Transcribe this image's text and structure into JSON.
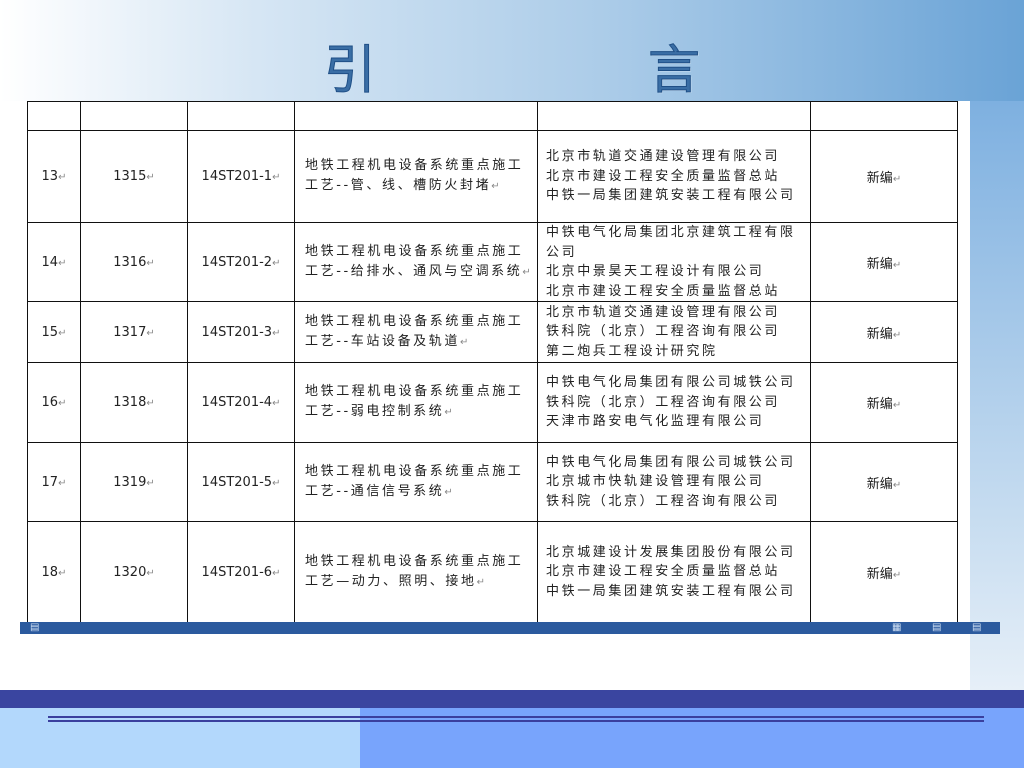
{
  "title": "引　言",
  "rows": [
    {
      "no": "13",
      "code": "1315",
      "std": "14ST201-1",
      "name": "地铁工程机电设备系统重点施工工艺--管、线、槽防火封堵",
      "orgs": [
        "北京市轨道交通建设管理有限公司",
        "北京市建设工程安全质量监督总站",
        "中铁一局集团建筑安装工程有限公司"
      ],
      "type": "新编"
    },
    {
      "no": "14",
      "code": "1316",
      "std": "14ST201-2",
      "name": "地铁工程机电设备系统重点施工工艺--给排水、通风与空调系统",
      "orgs": [
        "中铁电气化局集团北京建筑工程有限公司",
        "北京中景昊天工程设计有限公司",
        "北京市建设工程安全质量监督总站"
      ],
      "type": "新编"
    },
    {
      "no": "15",
      "code": "1317",
      "std": "14ST201-3",
      "name": "地铁工程机电设备系统重点施工工艺--车站设备及轨道",
      "orgs": [
        "北京市轨道交通建设管理有限公司",
        "铁科院（北京）工程咨询有限公司",
        "第二炮兵工程设计研究院"
      ],
      "type": "新编"
    },
    {
      "no": "16",
      "code": "1318",
      "std": "14ST201-4",
      "name": "地铁工程机电设备系统重点施工工艺--弱电控制系统",
      "orgs": [
        "中铁电气化局集团有限公司城铁公司",
        "铁科院（北京）工程咨询有限公司",
        "天津市路安电气化监理有限公司"
      ],
      "type": "新编"
    },
    {
      "no": "17",
      "code": "1319",
      "std": "14ST201-5",
      "name": "地铁工程机电设备系统重点施工工艺--通信信号系统",
      "orgs": [
        "中铁电气化局集团有限公司城铁公司",
        "北京城市快轨建设管理有限公司",
        "铁科院（北京）工程咨询有限公司"
      ],
      "type": "新编"
    },
    {
      "no": "18",
      "code": "1320",
      "std": "14ST201-6",
      "name": "地铁工程机电设备系统重点施工工艺—动力、照明、接地",
      "orgs": [
        "北京城建设计发展集团股份有限公司",
        "北京市建设工程安全质量监督总站",
        "中铁一局集团建筑安装工程有限公司"
      ],
      "type": "新编"
    }
  ],
  "colors": {
    "band": "#3a45a0",
    "status": "#2b5a9e"
  }
}
